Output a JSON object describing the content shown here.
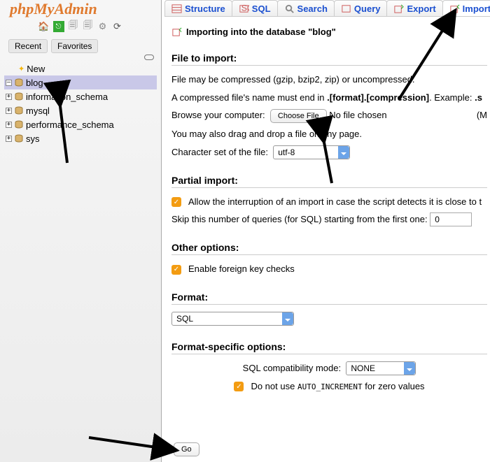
{
  "logo": "phpMyAdmin",
  "sidebar_tabs": {
    "recent": "Recent",
    "favorites": "Favorites"
  },
  "tree": {
    "new": "New",
    "items": [
      "blog",
      "information_schema",
      "mysql",
      "performance_schema",
      "sys"
    ]
  },
  "tabs": {
    "structure": "Structure",
    "sql": "SQL",
    "search": "Search",
    "query": "Query",
    "export": "Export",
    "import": "Import"
  },
  "heading": "Importing into the database \"blog\"",
  "file_to_import": {
    "title": "File to import:",
    "l1": "File may be compressed (gzip, bzip2, zip) or uncompressed.",
    "l2a": "A compressed file's name must end in ",
    "l2b": ".[format].[compression]",
    "l2c": ". Example: ",
    "l2d": ".s",
    "browse": "Browse your computer:",
    "choose": "Choose File",
    "nofile": "No file chosen",
    "max": "(M",
    "drag": "You may also drag and drop a file on any page.",
    "charset": "Character set of the file:",
    "charset_val": "utf-8"
  },
  "partial": {
    "title": "Partial import:",
    "allow": "Allow the interruption of an import in case the script detects it is close to t",
    "skip": "Skip this number of queries (for SQL) starting from the first one:",
    "skip_val": "0"
  },
  "other": {
    "title": "Other options:",
    "fk": "Enable foreign key checks"
  },
  "format": {
    "title": "Format:",
    "val": "SQL"
  },
  "fso": {
    "title": "Format-specific options:",
    "compat": "SQL compatibility mode:",
    "compat_val": "NONE",
    "ai1": "Do not use ",
    "ai2": "AUTO_INCREMENT",
    "ai3": " for zero values"
  },
  "go": "Go"
}
